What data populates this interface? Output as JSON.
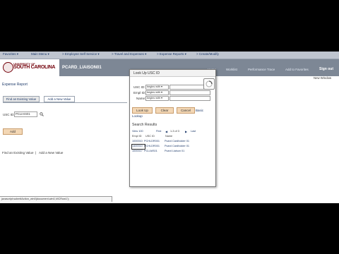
{
  "nav": {
    "items": [
      "Favorites ▾",
      "Main Menu ▾",
      "> Employee Self Service ▾",
      "> Travel and Expenses ▾",
      "> Expense Reports ▾",
      "> Create/Modify"
    ]
  },
  "header": {
    "logo_line1": "UNIVERSITY OF",
    "logo_line2": "SOUTH CAROLINA",
    "app_title": "PCARD_LIAISON01",
    "links": [
      "Home",
      "Worklist",
      "Performance Trace",
      "Add to Favorites"
    ],
    "sign_out": "Sign out"
  },
  "page": {
    "title": "Expense Report",
    "new_window": "New Window",
    "tabs": [
      "Find an Existing Value",
      "Add a New Value"
    ],
    "field_label": "USC ID:",
    "field_value": "PCLIAIS01",
    "add_button": "Add",
    "bottom_links": [
      "Find an Existing Value",
      "Add a New Value"
    ],
    "bottom_separator": "|"
  },
  "lookup": {
    "title": "Look Up USC ID",
    "fields": [
      {
        "label": "USC ID:",
        "operator": "begins with ▾"
      },
      {
        "label": "Empl ID:",
        "operator": "begins with ▾"
      },
      {
        "label": "Name:",
        "operator": "begins with ▾"
      }
    ],
    "buttons": {
      "lookup": "Look Up",
      "clear": "Clear",
      "cancel": "Cancel",
      "basic_prefix": "Basic",
      "basic_suffix": "Lookup"
    },
    "results_title": "Search Results",
    "pager": {
      "view": "View 100",
      "first": "First",
      "range": "1-3 of 3",
      "last": "Last"
    },
    "columns": [
      "Empl ID",
      "USC ID",
      "Name"
    ],
    "rows": [
      {
        "empl_id": "1000010",
        "usc_id": "PCHLDR001",
        "name": "Pcard Cardholder 01"
      },
      {
        "empl_id": "1400010",
        "usc_id": "PCHLDR001",
        "name": "Pcard Cardholder 01"
      },
      {
        "empl_id": "1000017",
        "usc_id": "PCLIAIS01",
        "name": "Pcard Liaison 01"
      }
    ]
  },
  "status_bar": "javascript:submitAction_win0(document.win0,'#ICRow1');"
}
